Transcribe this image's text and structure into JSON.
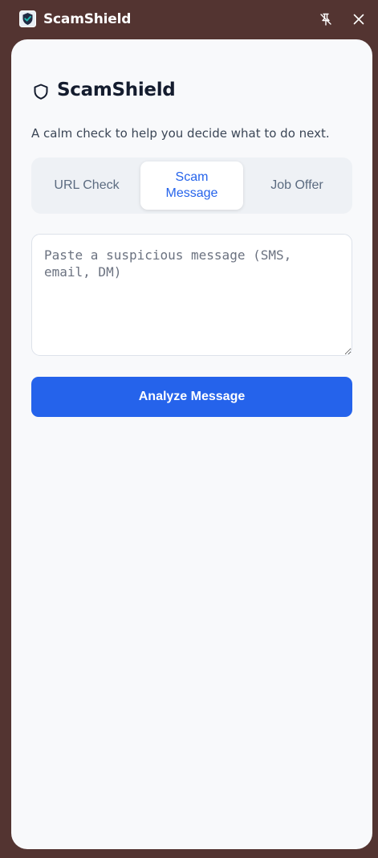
{
  "window": {
    "title": "ScamShield"
  },
  "header": {
    "title": "ScamShield",
    "subtitle": "A calm check to help you decide what to do next."
  },
  "tabs": [
    {
      "label": "URL Check",
      "active": false
    },
    {
      "label": "Scam Message",
      "active": true
    },
    {
      "label": "Job Offer",
      "active": false
    }
  ],
  "message_input": {
    "value": "",
    "placeholder": "Paste a suspicious message (SMS, email, DM)"
  },
  "analyze_button": {
    "label": "Analyze Message"
  },
  "icons": {
    "app_logo": "shield-check-icon",
    "heading": "shield-icon",
    "pin": "pin-off-icon",
    "close": "close-icon"
  },
  "colors": {
    "window_frame": "#533431",
    "panel_background": "#f8f9fb",
    "accent": "#2563eb",
    "title_text": "#141c2e"
  }
}
